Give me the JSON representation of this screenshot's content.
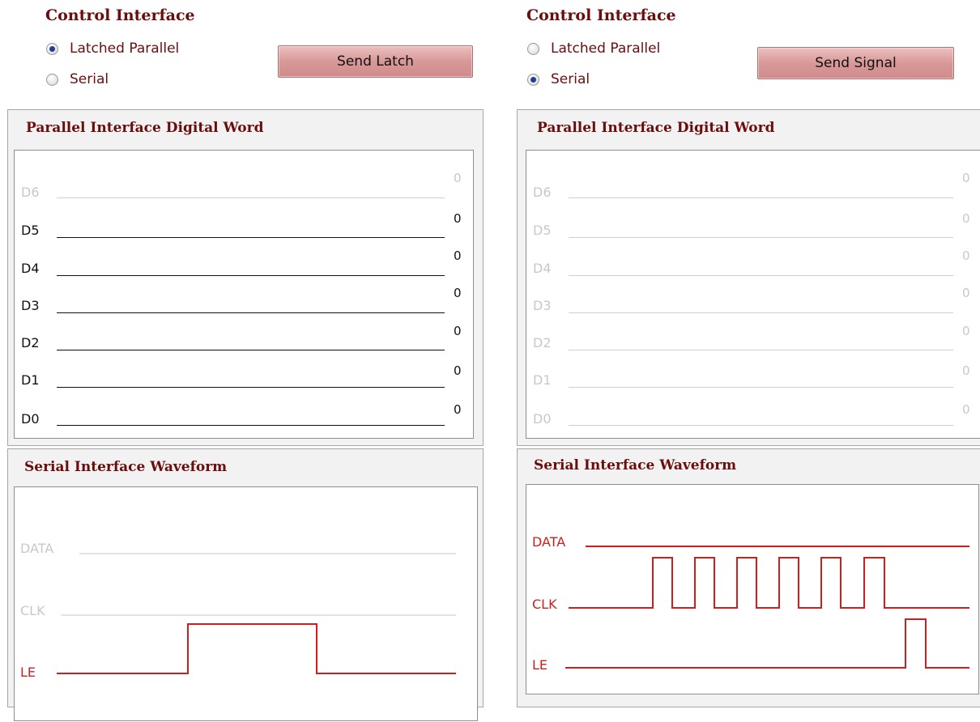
{
  "panels": [
    {
      "id": "left",
      "control": {
        "title": "Control Interface",
        "options": [
          {
            "label": "Latched Parallel",
            "checked": true
          },
          {
            "label": "Serial",
            "checked": false
          }
        ],
        "button": "Send Latch"
      },
      "parallel": {
        "title": "Parallel Interface Digital Word",
        "bits": [
          {
            "name": "D6",
            "value": "0",
            "enabled": false
          },
          {
            "name": "D5",
            "value": "0",
            "enabled": true
          },
          {
            "name": "D4",
            "value": "0",
            "enabled": true
          },
          {
            "name": "D3",
            "value": "0",
            "enabled": true
          },
          {
            "name": "D2",
            "value": "0",
            "enabled": true
          },
          {
            "name": "D1",
            "value": "0",
            "enabled": true
          },
          {
            "name": "D0",
            "value": "0",
            "enabled": true
          }
        ]
      },
      "serial": {
        "title": "Serial Interface Waveform",
        "signals": [
          {
            "name": "DATA",
            "active": false
          },
          {
            "name": "CLK",
            "active": false
          },
          {
            "name": "LE",
            "active": true
          }
        ]
      }
    },
    {
      "id": "right",
      "control": {
        "title": "Control Interface",
        "options": [
          {
            "label": "Latched Parallel",
            "checked": false
          },
          {
            "label": "Serial",
            "checked": true
          }
        ],
        "button": "Send Signal"
      },
      "parallel": {
        "title": "Parallel Interface Digital Word",
        "bits": [
          {
            "name": "D6",
            "value": "0",
            "enabled": false
          },
          {
            "name": "D5",
            "value": "0",
            "enabled": false
          },
          {
            "name": "D4",
            "value": "0",
            "enabled": false
          },
          {
            "name": "D3",
            "value": "0",
            "enabled": false
          },
          {
            "name": "D2",
            "value": "0",
            "enabled": false
          },
          {
            "name": "D1",
            "value": "0",
            "enabled": false
          },
          {
            "name": "D0",
            "value": "0",
            "enabled": false
          }
        ]
      },
      "serial": {
        "title": "Serial Interface Waveform",
        "signals": [
          {
            "name": "DATA",
            "active": true
          },
          {
            "name": "CLK",
            "active": true
          },
          {
            "name": "LE",
            "active": true
          }
        ]
      }
    }
  ],
  "colors": {
    "active_wave": "#cc1f1f",
    "inactive_wave": "#d2d2d2",
    "title": "#6b0d0d",
    "button": "#d99898"
  }
}
